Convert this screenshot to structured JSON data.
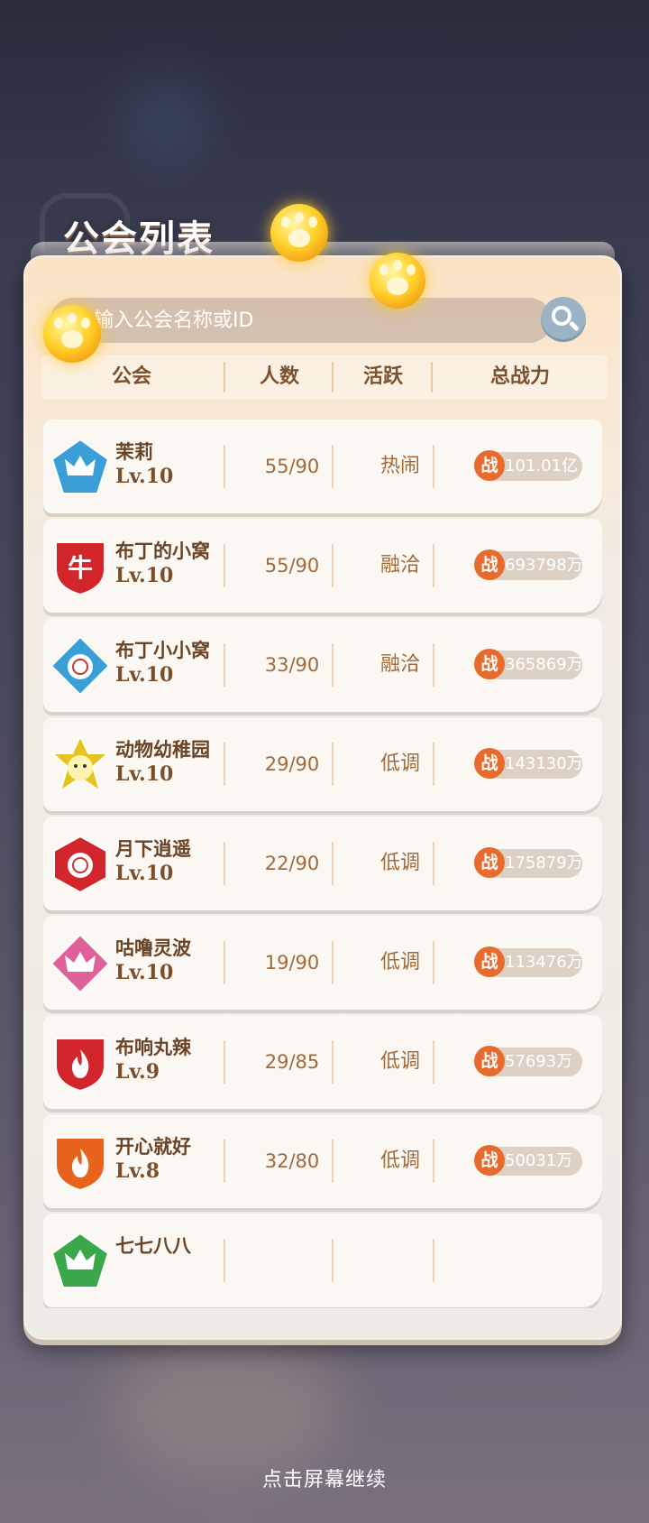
{
  "title": "公会列表",
  "search": {
    "placeholder": "输入公会名称或ID"
  },
  "headers": {
    "guild": "公会",
    "members": "人数",
    "activity": "活跃",
    "power": "总战力"
  },
  "power_badge": "战",
  "guilds": [
    {
      "name": "茉莉",
      "level": "Lv.10",
      "members": "55/90",
      "activity": "热闹",
      "power": "101.01亿",
      "emblem": "crown",
      "emblem_color": "#3a9fd6",
      "emblem_shape": "pentagon"
    },
    {
      "name": "布丁的小窝",
      "level": "Lv.10",
      "members": "55/90",
      "activity": "融洽",
      "power": "693798万",
      "emblem": "ox",
      "emblem_color": "#d2262c",
      "emblem_shape": "shield"
    },
    {
      "name": "布丁小小窝",
      "level": "Lv.10",
      "members": "33/90",
      "activity": "融洽",
      "power": "365869万",
      "emblem": "rose",
      "emblem_color": "#3a9fd6",
      "emblem_shape": "diamond"
    },
    {
      "name": "动物幼稚园",
      "level": "Lv.10",
      "members": "29/90",
      "activity": "低调",
      "power": "143130万",
      "emblem": "cat",
      "emblem_color": "#e6c320",
      "emblem_shape": "star"
    },
    {
      "name": "月下逍遥",
      "level": "Lv.10",
      "members": "22/90",
      "activity": "低调",
      "power": "175879万",
      "emblem": "rose",
      "emblem_color": "#d2262c",
      "emblem_shape": "hexagon"
    },
    {
      "name": "咕噜灵波",
      "level": "Lv.10",
      "members": "19/90",
      "activity": "低调",
      "power": "113476万",
      "emblem": "crown",
      "emblem_color": "#e0609a",
      "emblem_shape": "diamond"
    },
    {
      "name": "布响丸辣",
      "level": "Lv.9",
      "members": "29/85",
      "activity": "低调",
      "power": "57693万",
      "emblem": "flame",
      "emblem_color": "#d2262c",
      "emblem_shape": "shield"
    },
    {
      "name": "开心就好",
      "level": "Lv.8",
      "members": "32/80",
      "activity": "低调",
      "power": "50031万",
      "emblem": "flame",
      "emblem_color": "#e8641e",
      "emblem_shape": "shield"
    },
    {
      "name": "七七八八",
      "level": "",
      "members": "",
      "activity": "",
      "power": "",
      "emblem": "crown",
      "emblem_color": "#3aa84a",
      "emblem_shape": "pentagon"
    }
  ],
  "footer_hint": "点击屏幕继续"
}
